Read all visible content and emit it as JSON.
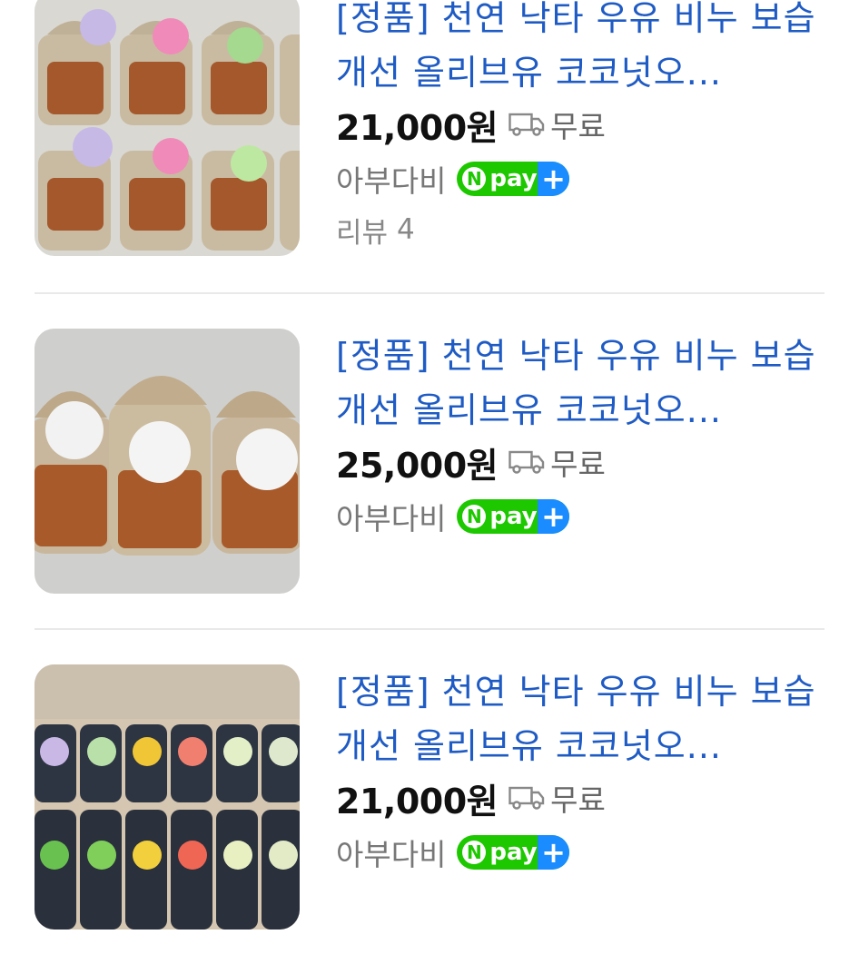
{
  "products": [
    {
      "title": "[정품] 천연 낙타 우유 비누 보습 개선 올리브유 코코넛오...",
      "price": "21,000원",
      "shipping": "무료",
      "seller": "아부다비",
      "npay": {
        "n": "N",
        "label": "pay",
        "plus": "+"
      },
      "review_label": "리뷰",
      "review_count": "4",
      "image_icon": "soap-bags-photo"
    },
    {
      "title": "[정품] 천연 낙타 우유 비누 보습 개선 올리브유 코코넛오...",
      "price": "25,000원",
      "shipping": "무료",
      "seller": "아부다비",
      "npay": {
        "n": "N",
        "label": "pay",
        "plus": "+"
      },
      "image_icon": "soap-bags-photo"
    },
    {
      "title": "[정품] 천연 낙타 우유 비누 보습 개선 올리브유 코코넛오...",
      "price": "21,000원",
      "shipping": "무료",
      "seller": "아부다비",
      "npay": {
        "n": "N",
        "label": "pay",
        "plus": "+"
      },
      "image_icon": "soap-bags-photo"
    }
  ],
  "colors": {
    "title_link": "#1f5bc4",
    "npay_green": "#1ec800",
    "npay_blue": "#1a8cff"
  }
}
